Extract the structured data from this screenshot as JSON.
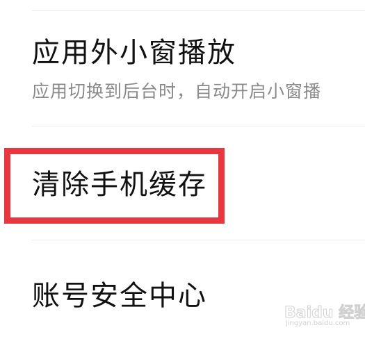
{
  "settings_list": {
    "items": [
      {
        "title": "应用外小窗播放",
        "subtitle": "应用切换到后台时，自动开启小窗播"
      },
      {
        "title": "清除手机缓存",
        "highlighted": true
      },
      {
        "title": "账号安全中心"
      }
    ]
  },
  "annotation": {
    "highlight_color": "#e8373f"
  },
  "watermark": {
    "brand": "Baidu 经验",
    "url": "jingyan.baidu.com"
  }
}
